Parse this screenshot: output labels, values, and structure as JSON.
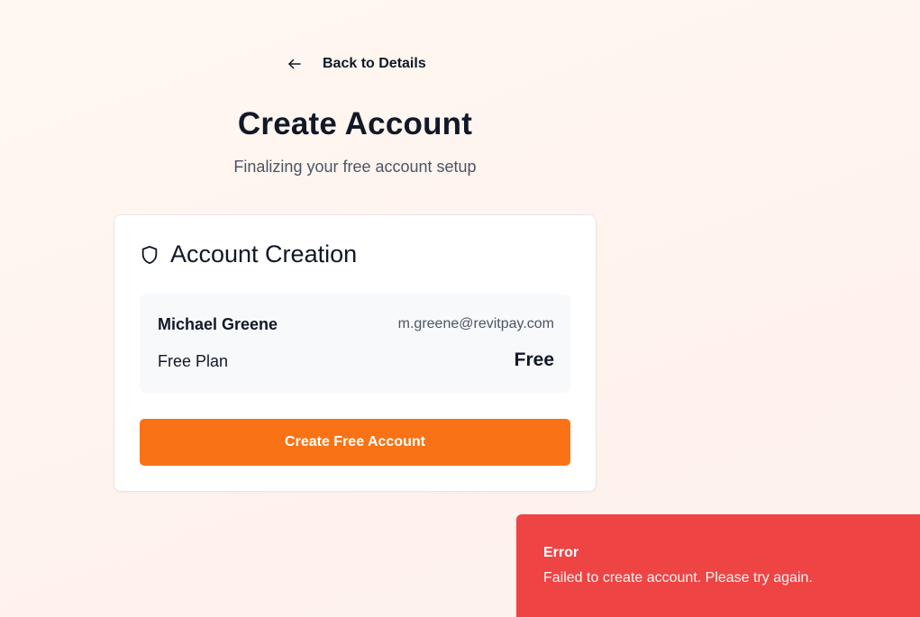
{
  "nav": {
    "back_label": "Back to Details",
    "back_icon": "arrow-left-icon"
  },
  "header": {
    "title": "Create Account",
    "subtitle": "Finalizing your free account setup"
  },
  "card": {
    "icon": "shield-icon",
    "title": "Account Creation",
    "user_name": "Michael Greene",
    "user_email": "m.greene@revitpay.com",
    "plan_name": "Free Plan",
    "plan_price": "Free",
    "create_button_label": "Create Free Account"
  },
  "toast": {
    "title": "Error",
    "message": "Failed to create account. Please try again."
  },
  "colors": {
    "accent": "#f97316",
    "error": "#ef4444",
    "text": "#111827",
    "muted": "#4b5563"
  }
}
